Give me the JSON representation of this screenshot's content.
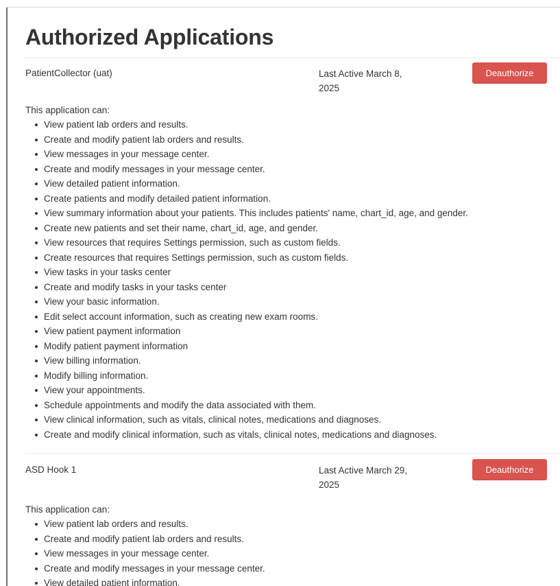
{
  "page": {
    "title": "Authorized Applications"
  },
  "apps": [
    {
      "name": "PatientCollector (uat)",
      "last_active": "Last Active March 8, 2025",
      "deauthorize_label": "Deauthorize",
      "permissions_label": "This application can:",
      "permissions": [
        "View patient lab orders and results.",
        "Create and modify patient lab orders and results.",
        "View messages in your message center.",
        "Create and modify messages in your message center.",
        "View detailed patient information.",
        "Create patients and modify detailed patient information.",
        "View summary information about your patients. This includes patients' name, chart_id, age, and gender.",
        "Create new patients and set their name, chart_id, age, and gender.",
        "View resources that requires Settings permission, such as custom fields.",
        "Create resources that requires Settings permission, such as custom fields.",
        "View tasks in your tasks center",
        "Create and modify tasks in your tasks center",
        "View your basic information.",
        "Edit select account information, such as creating new exam rooms.",
        "View patient payment information",
        "Modify patient payment information",
        "View billing information.",
        "Modify billing information.",
        "View your appointments.",
        "Schedule appointments and modify the data associated with them.",
        "View clinical information, such as vitals, clinical notes, medications and diagnoses.",
        "Create and modify clinical information, such as vitals, clinical notes, medications and diagnoses."
      ]
    },
    {
      "name": "ASD Hook 1",
      "last_active": "Last Active March 29, 2025",
      "deauthorize_label": "Deauthorize",
      "permissions_label": "This application can:",
      "permissions": [
        "View patient lab orders and results.",
        "Create and modify patient lab orders and results.",
        "View messages in your message center.",
        "Create and modify messages in your message center.",
        "View detailed patient information."
      ]
    }
  ],
  "colors": {
    "button_red": "#d9534f",
    "text": "#333333",
    "divider": "#ececec"
  }
}
